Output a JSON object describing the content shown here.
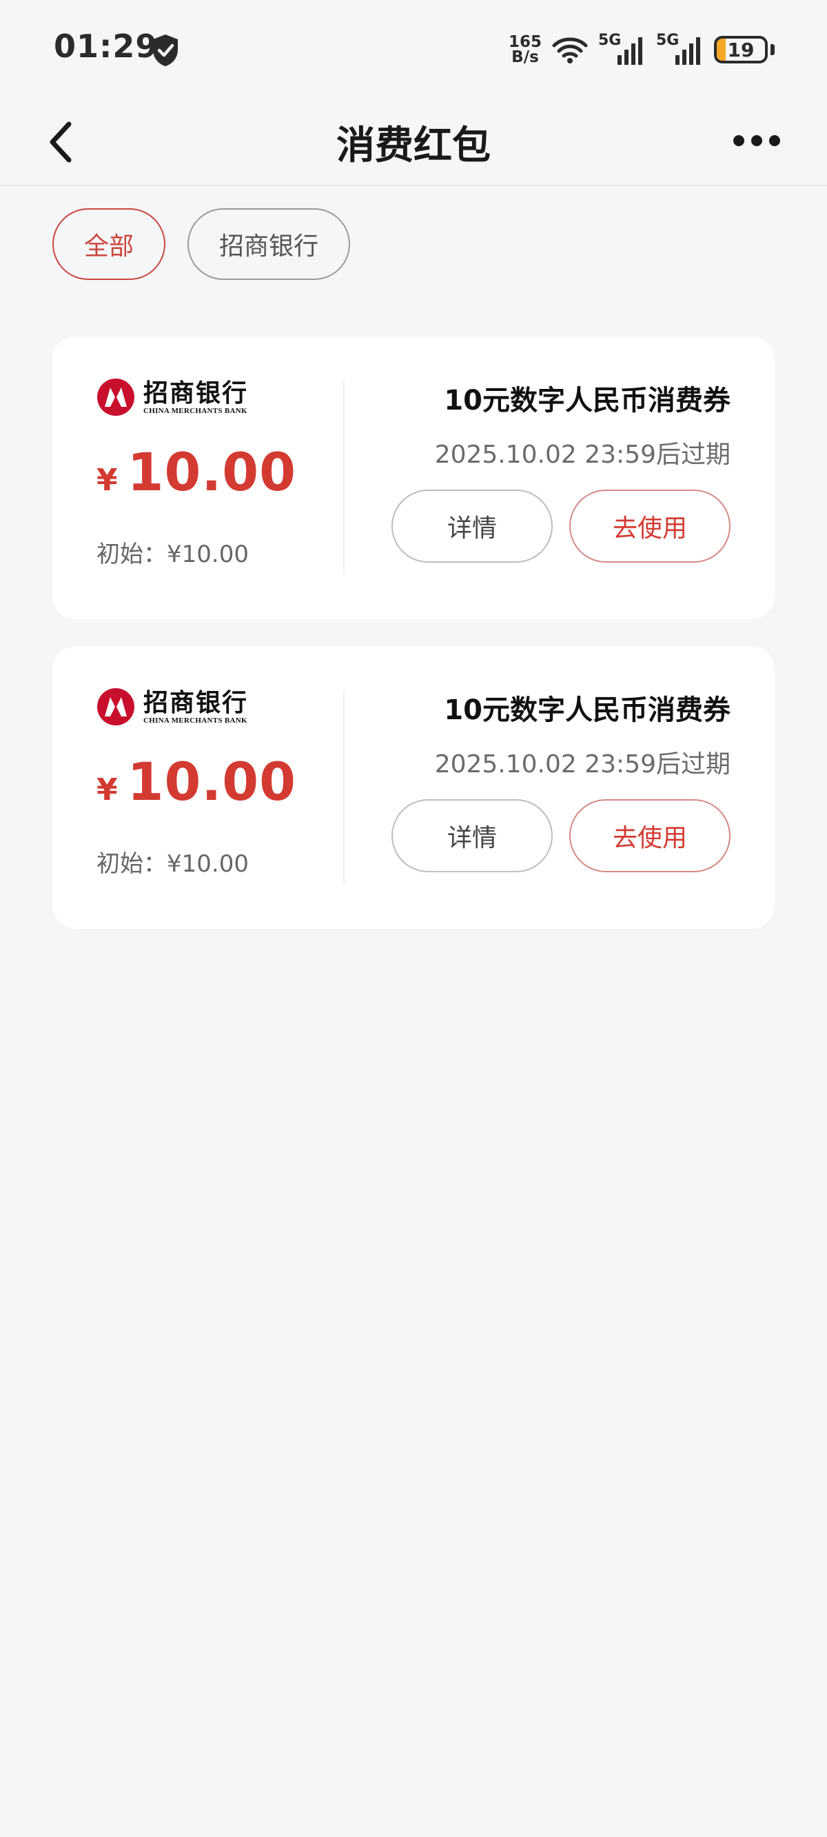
{
  "status_bar": {
    "time": "01:29",
    "net_speed_value": "165",
    "net_speed_unit": "B/s",
    "sim1_label": "5G",
    "sim2_label": "5G",
    "battery": "19",
    "battery_level": 0.19
  },
  "header": {
    "title": "消费红包"
  },
  "filters": [
    {
      "label": "全部",
      "active": true
    },
    {
      "label": "招商银行",
      "active": false
    }
  ],
  "coupons": [
    {
      "bank_name_cn": "招商银行",
      "bank_name_en": "CHINA MERCHANTS BANK",
      "currency": "¥",
      "amount": "10.00",
      "initial_label": "初始：¥10.00",
      "title": "10元数字人民币消费券",
      "expiry": "2025.10.02 23:59后过期",
      "detail_label": "详情",
      "use_label": "去使用"
    },
    {
      "bank_name_cn": "招商银行",
      "bank_name_en": "CHINA MERCHANTS BANK",
      "currency": "¥",
      "amount": "10.00",
      "initial_label": "初始：¥10.00",
      "title": "10元数字人民币消费券",
      "expiry": "2025.10.02 23:59后过期",
      "detail_label": "详情",
      "use_label": "去使用"
    }
  ],
  "colors": {
    "accent": "#d33a31",
    "background": "#f5f6f8",
    "card": "#ffffff",
    "battery": "#f5a623"
  }
}
